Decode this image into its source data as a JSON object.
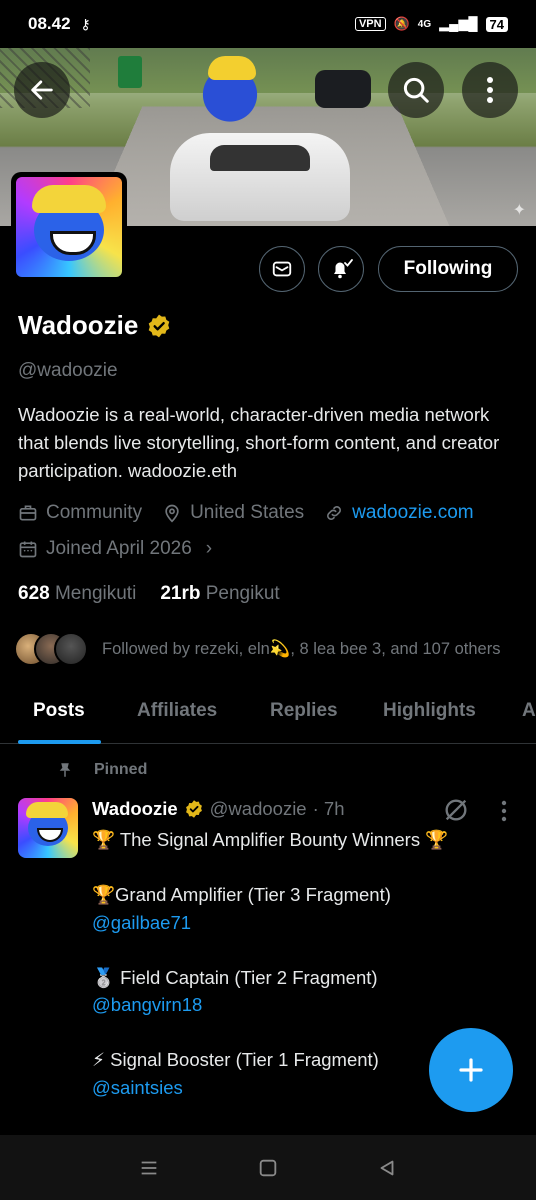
{
  "status_bar": {
    "time": "08.42",
    "vpn": "VPN",
    "network": "4G",
    "battery": "74"
  },
  "profile": {
    "display_name": "Wadoozie",
    "handle": "@wadoozie",
    "bio": "Wadoozie is a real-world, character-driven media network that blends live storytelling, short-form content, and creator participation. wadoozie.eth",
    "category": "Community",
    "location": "United States",
    "website": "wadoozie.com",
    "joined": "Joined April 2026",
    "following_count": "628",
    "following_label": "Mengikuti",
    "followers_count": "21rb",
    "followers_label": "Pengikut",
    "followed_by": "Followed by rezeki, eln💫, 8 lea bee 3, and 107 others",
    "following_button": "Following"
  },
  "tabs": [
    {
      "label": "Posts",
      "active": true
    },
    {
      "label": "Affiliates"
    },
    {
      "label": "Replies"
    },
    {
      "label": "Highlights"
    },
    {
      "label": "A"
    }
  ],
  "pinned_post": {
    "pinned_label": "Pinned",
    "author_name": "Wadoozie",
    "author_handle": "@wadoozie",
    "time": "· 7h",
    "line_1": "🏆 The Signal Amplifier Bounty Winners 🏆",
    "line_2": "🏆Grand Amplifier (Tier 3 Fragment)",
    "mention_1": "@gailbae71",
    "line_3": "🥈 Field Captain (Tier 2 Fragment)",
    "mention_2": "@bangvirn18",
    "line_4": "⚡ Signal Booster (Tier 1 Fragment)",
    "mention_3": "@saintsies"
  },
  "colors": {
    "accent": "#1d9bf0",
    "verified": "#e2b719",
    "muted": "#71767b",
    "background": "#000000"
  }
}
